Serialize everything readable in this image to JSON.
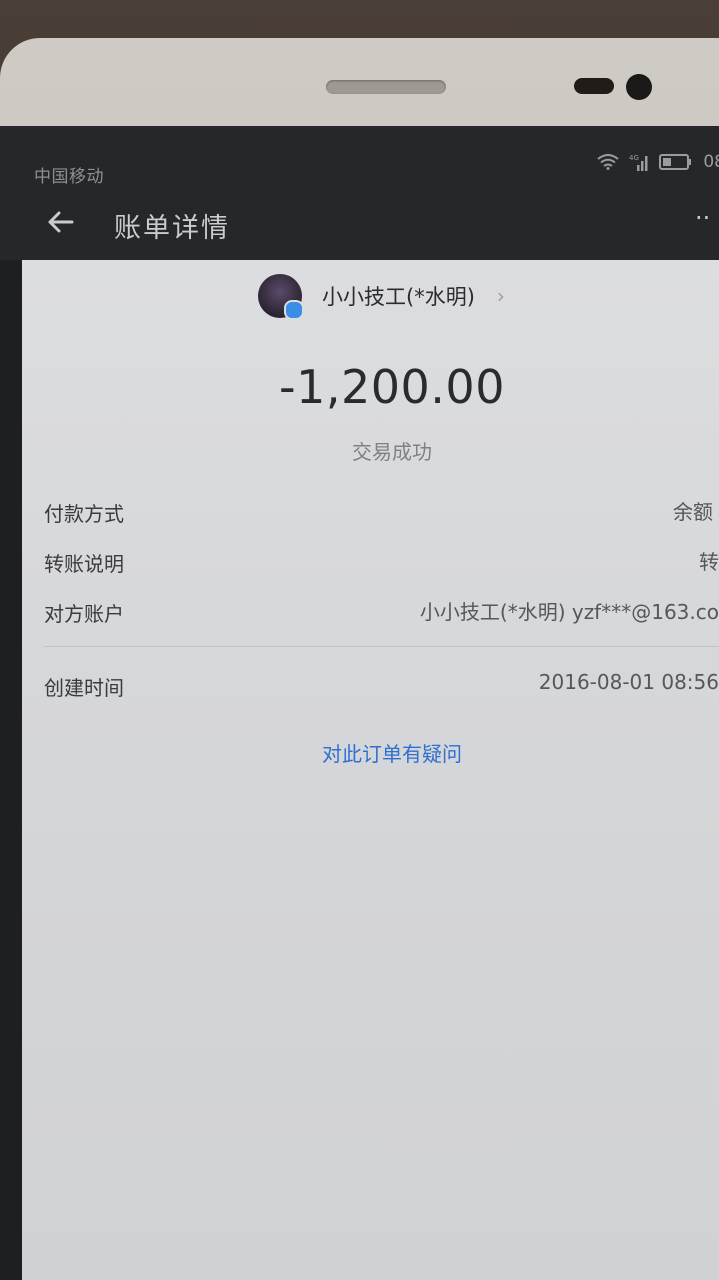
{
  "status_bar": {
    "carrier": "中国移动",
    "network": "4G",
    "time": "08"
  },
  "app_bar": {
    "title": "账单详情",
    "more": "··"
  },
  "payee": {
    "name": "小小技工(*水明)"
  },
  "transaction": {
    "amount": "-1,200.00",
    "status": "交易成功"
  },
  "details": [
    {
      "label": "付款方式",
      "value": "余额"
    },
    {
      "label": "转账说明",
      "value": "转"
    },
    {
      "label": "对方账户",
      "value": "小小技工(*水明) yzf***@163.co"
    },
    {
      "label": "创建时间",
      "value": "2016-08-01 08:56"
    }
  ],
  "actions": {
    "question_link": "对此订单有疑问"
  },
  "colors": {
    "link": "#2f6fcf",
    "verified_badge": "#3a8ee6"
  },
  "icons": [
    "back-arrow-icon",
    "more-icon",
    "wifi-icon",
    "signal-icon",
    "battery-icon",
    "verified-icon",
    "chevron-right-icon"
  ]
}
